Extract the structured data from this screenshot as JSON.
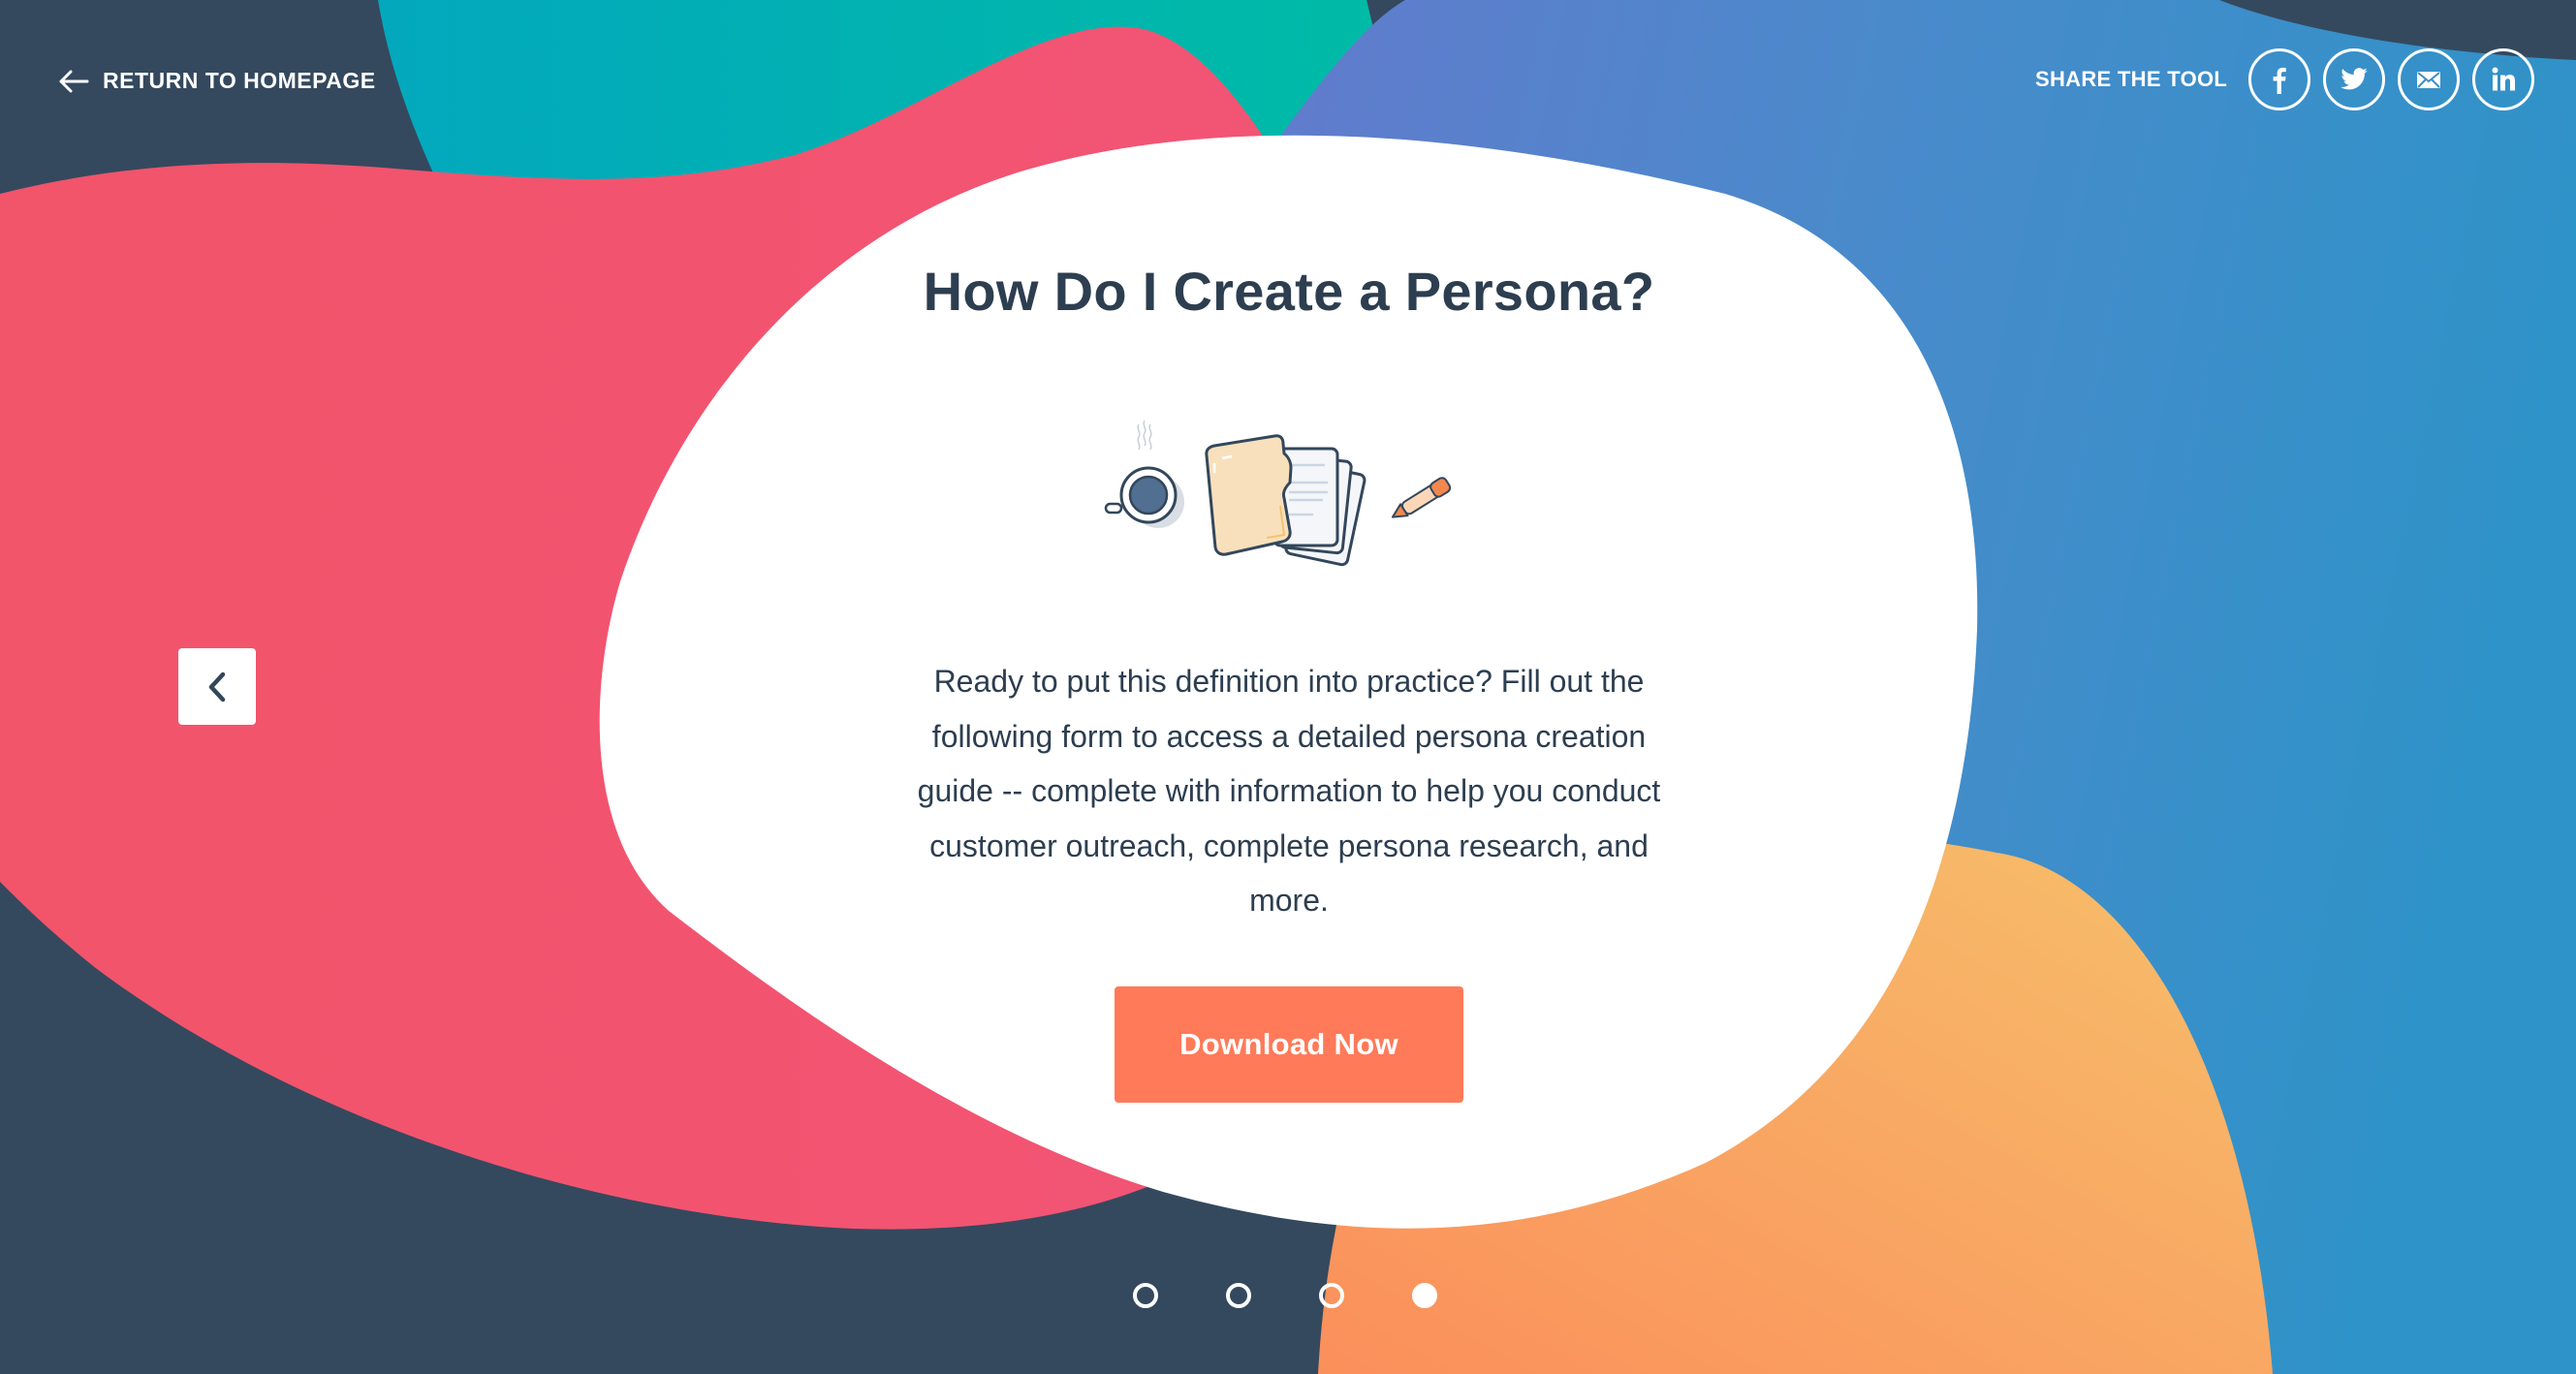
{
  "nav": {
    "return_label": "RETURN TO HOMEPAGE",
    "return_icon": "arrow-left-icon"
  },
  "share": {
    "label": "SHARE THE TOOL",
    "networks": [
      {
        "name": "facebook",
        "icon": "facebook-icon"
      },
      {
        "name": "twitter",
        "icon": "twitter-icon"
      },
      {
        "name": "email",
        "icon": "email-icon"
      },
      {
        "name": "linkedin",
        "icon": "linkedin-icon"
      }
    ]
  },
  "card": {
    "title": "How Do I Create a Persona?",
    "illustration": "coffee-folder-documents-pen-illustration",
    "description": "Ready to put this definition into practice? Fill out the following form to access a detailed persona creation guide -- complete with information to help you conduct customer outreach, complete persona research, and more.",
    "cta_label": "Download Now"
  },
  "carousel": {
    "prev_icon": "chevron-left-icon",
    "slide_count": 4,
    "active_slide": 4
  },
  "colors": {
    "background": "#34495e",
    "text_dark": "#2d3e50",
    "cta": "#ff7a59",
    "blob_red": "#f2546b",
    "blob_teal": "#00afb5",
    "blob_blue": "#4a8ccc",
    "blob_orange": "#f8a55f",
    "card": "#ffffff"
  }
}
